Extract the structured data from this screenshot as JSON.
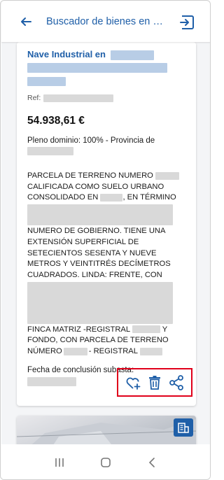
{
  "app_bar": {
    "title": "Buscador de bienes en s...",
    "back_icon": "arrow-left-icon",
    "exit_icon": "exit-icon"
  },
  "card": {
    "title_prefix": "Nave Industrial en",
    "ref_label": "Ref:",
    "price": "54.938,61 €",
    "pleno_dominio": "Pleno dominio: 100% - Provincia de",
    "desc": {
      "line1_prefix": "PARCELA DE TERRENO NUMERO",
      "line2": "CALIFICADA COMO SUELO URBANO",
      "line3_prefix": "CONSOLIDADO EN",
      "line3_suffix": ", EN TÉRMINO",
      "line5": "NUMERO DE GOBIERNO. TIENE UNA",
      "line6": "EXTENSIÓN SUPERFICIAL DE",
      "line7": "SETECIENTOS SESENTA Y NUEVE",
      "line8": "METROS Y VEINTITRÉS DECÍMETROS",
      "line9": "CUADRADOS. LINDA: FRENTE, CON",
      "line13_prefix": "FINCA MATRIZ -REGISTRAL",
      "line13_suffix": "Y",
      "line14": "FONDO, CON PARCELA DE TERRENO",
      "line15_prefix": "NÚMERO",
      "line15_suffix": "- REGISTRAL"
    },
    "fecha_label": "Fecha de conclusión subasta:",
    "actions": {
      "favorite_icon": "heart-plus-icon",
      "delete_icon": "trash-icon",
      "share_icon": "share-icon"
    }
  },
  "colors": {
    "accent": "#1f5fa8",
    "highlight_border": "#e0001a",
    "blur": "#d9d9d9"
  },
  "navbar": {
    "recent_icon": "recent-apps-icon",
    "home_icon": "home-icon",
    "back_icon": "chevron-left-icon"
  }
}
